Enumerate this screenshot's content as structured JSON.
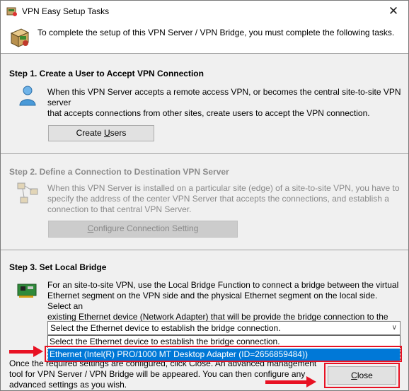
{
  "window": {
    "title": "VPN Easy Setup Tasks",
    "close_glyph": "✕"
  },
  "header": {
    "intro": "To complete the setup of this VPN Server / VPN Bridge, you must complete the following tasks.",
    "icon": "setup-box-icon"
  },
  "step1": {
    "title": "Step 1. Create a User to Accept VPN Connection",
    "description_lines": [
      "When this VPN Server accepts a remote access VPN, or becomes the central site-to-site VPN server",
      "that accepts connections from other sites, create users to accept the VPN connection."
    ],
    "button_pre": "Create ",
    "button_accel": "U",
    "button_post": "sers",
    "icon": "user-icon"
  },
  "step2": {
    "title": "Step 2. Define a Connection to Destination VPN Server",
    "description_lines": [
      "When this VPN Server is installed on a particular site (edge) of a site-to-site VPN, you have to",
      "specify the address of the center VPN Server that accepts the connections, and establish a",
      "connection to that central VPN Server."
    ],
    "button_accel": "C",
    "button_post": "onfigure Connection Setting",
    "icon": "network-icon"
  },
  "step3": {
    "title": "Step 3. Set Local Bridge",
    "description_lines": [
      "For an site-to-site VPN, use the Local Bridge Function to connect a bridge between the virtual",
      "Ethernet segment on the VPN side and the physical Ethernet segment on the local side. Select an",
      "existing Ethernet device (Network Adapter) that will be provide the bridge connection to the VPN."
    ],
    "icon": "network-card-icon",
    "combo_value": "Select the Ethernet device to establish the bridge connection.",
    "options": [
      "Select the Ethernet device to establish the bridge connection.",
      "Ethernet (Intel(R) PRO/1000 MT Desktop Adapter (ID=2656859484))"
    ],
    "selected_index": 1
  },
  "footer": {
    "lines": [
      "Once the required settings are configured, click Close. An advanced management",
      "tool for VPN Server / VPN Bridge will be appeared. You can then configure any",
      "advanced settings as you wish."
    ],
    "close_accel": "C",
    "close_post": "lose"
  },
  "colors": {
    "highlight": "#0078d7",
    "annotation_red": "#e81123",
    "disabled_text": "#8a8a8a"
  }
}
